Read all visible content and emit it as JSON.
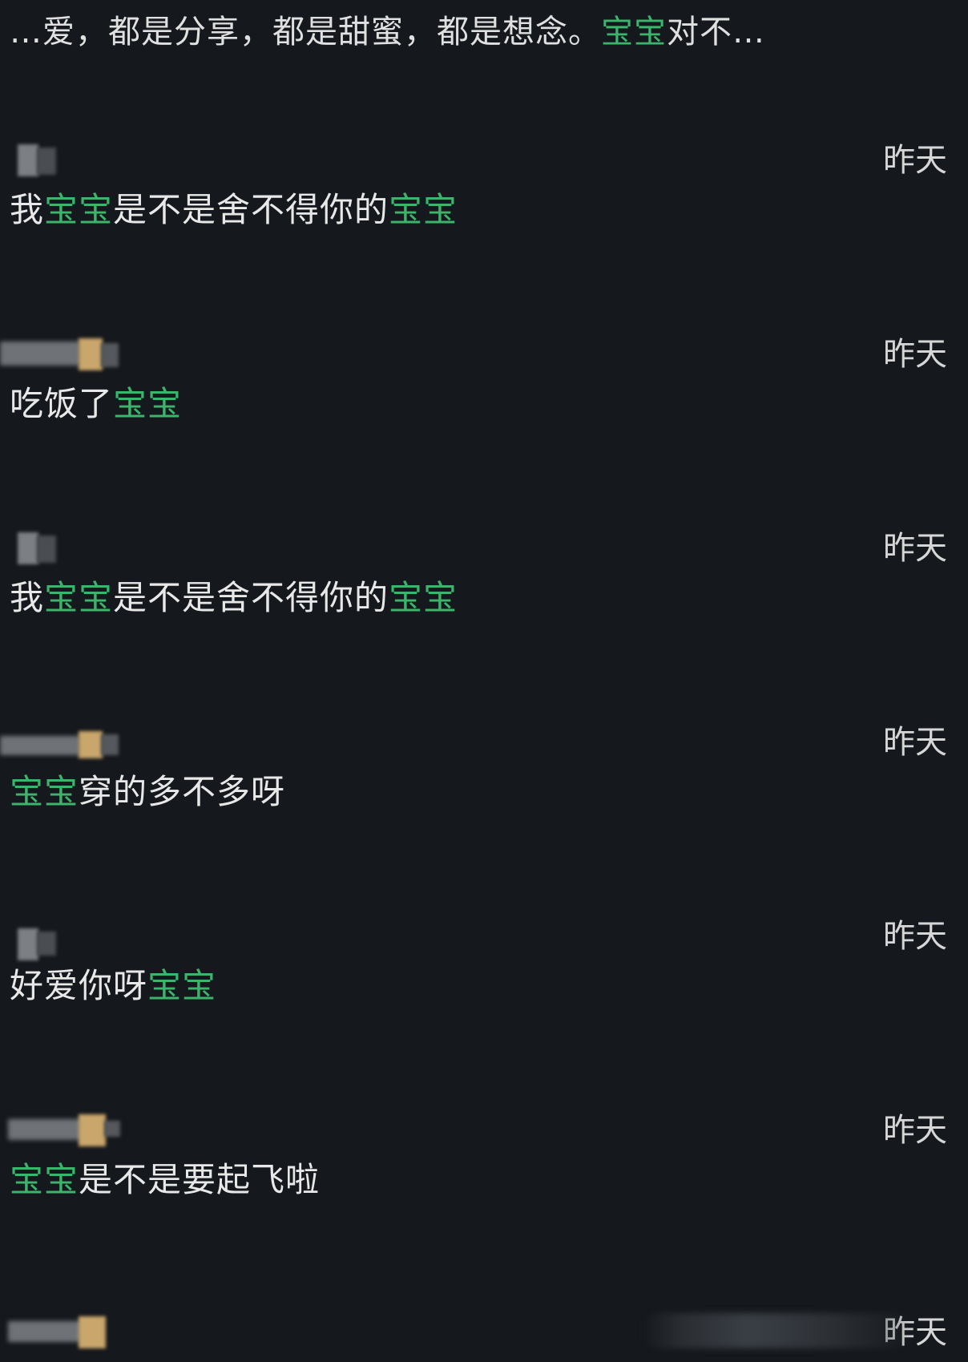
{
  "snippet": {
    "text_before": "…爱，都是分享，都是甜蜜，都是想念。",
    "highlight": "宝宝",
    "text_after": "对不…"
  },
  "comments": [
    {
      "time": "昨天",
      "parts": [
        {
          "t": "我",
          "h": false
        },
        {
          "t": "宝宝",
          "h": true
        },
        {
          "t": "是不是舍不得你的",
          "h": false
        },
        {
          "t": "宝宝",
          "h": true
        }
      ]
    },
    {
      "time": "昨天",
      "parts": [
        {
          "t": "吃饭了",
          "h": false
        },
        {
          "t": "宝宝",
          "h": true
        }
      ]
    },
    {
      "time": "昨天",
      "parts": [
        {
          "t": "我",
          "h": false
        },
        {
          "t": "宝宝",
          "h": true
        },
        {
          "t": "是不是舍不得你的",
          "h": false
        },
        {
          "t": "宝宝",
          "h": true
        }
      ]
    },
    {
      "time": "昨天",
      "parts": [
        {
          "t": "宝宝",
          "h": true
        },
        {
          "t": "穿的多不多呀",
          "h": false
        }
      ]
    },
    {
      "time": "昨天",
      "parts": [
        {
          "t": "好爱你呀",
          "h": false
        },
        {
          "t": "宝宝",
          "h": true
        }
      ]
    },
    {
      "time": "昨天",
      "parts": [
        {
          "t": "宝宝",
          "h": true
        },
        {
          "t": "是不是要起飞啦",
          "h": false
        }
      ]
    },
    {
      "time": "昨天",
      "parts": []
    }
  ],
  "colors": {
    "background": "#15181c",
    "highlight": "#3db46b",
    "text": "#e8e8e8"
  }
}
